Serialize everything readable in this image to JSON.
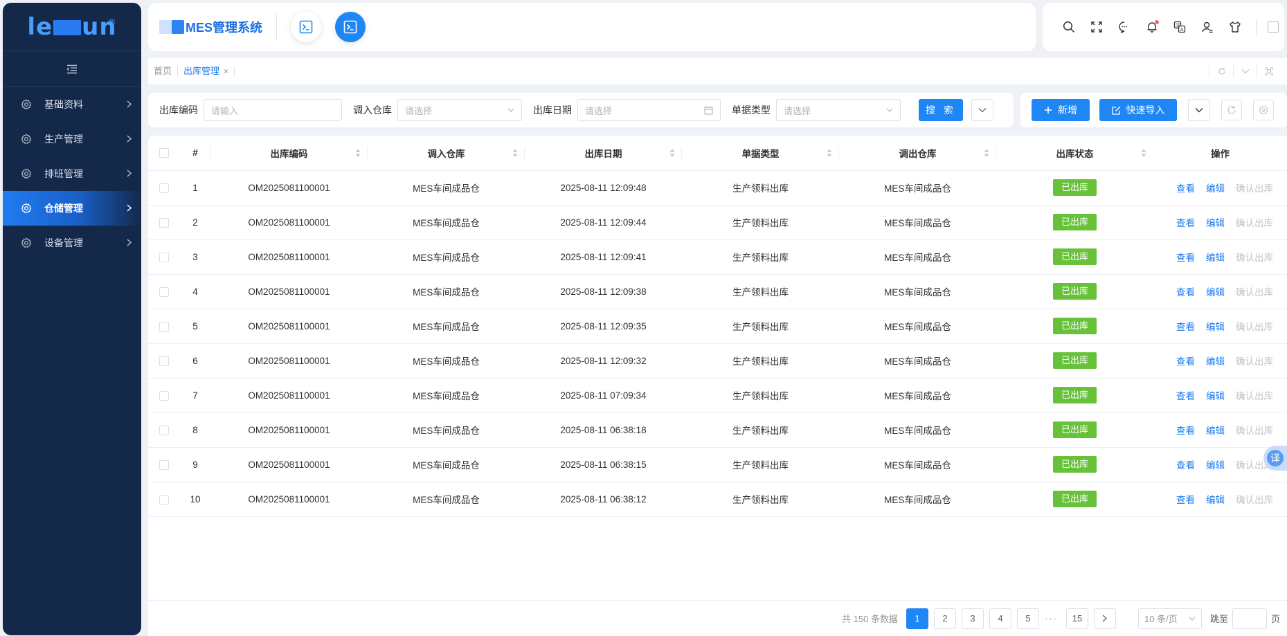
{
  "brand": {
    "logo_text_left": "le",
    "logo_text_right": "un",
    "logo_reg": "®"
  },
  "sidebar": {
    "items": [
      {
        "label": "基础资料",
        "icon": "gear-icon",
        "active": false
      },
      {
        "label": "生产管理",
        "icon": "gear-icon",
        "active": false
      },
      {
        "label": "排班管理",
        "icon": "gear-icon",
        "active": false
      },
      {
        "label": "仓储管理",
        "icon": "gear-icon",
        "active": true
      },
      {
        "label": "设备管理",
        "icon": "gear-icon",
        "active": false
      }
    ]
  },
  "header": {
    "system_title": "MES管理系统"
  },
  "tabs": {
    "home": "首页",
    "current": "出库管理"
  },
  "search": {
    "code_label": "出库编码",
    "code_placeholder": "请输入",
    "in_wh_label": "调入仓库",
    "in_wh_placeholder": "请选择",
    "date_label": "出库日期",
    "date_placeholder": "请选择",
    "type_label": "单据类型",
    "type_placeholder": "请选择",
    "search_btn": "搜 索"
  },
  "actions": {
    "add": "新增",
    "import": "快速导入"
  },
  "table": {
    "columns": [
      "#",
      "出库编码",
      "调入仓库",
      "出库日期",
      "单据类型",
      "调出仓库",
      "出库状态",
      "操作"
    ],
    "rows": [
      {
        "no": "1",
        "code": "OM2025081100001",
        "in_wh": "MES车间成品仓",
        "date": "2025-08-11 12:09:48",
        "type": "生产领料出库",
        "out_wh": "MES车间成品仓",
        "status": "已出库"
      },
      {
        "no": "2",
        "code": "OM2025081100001",
        "in_wh": "MES车间成品仓",
        "date": "2025-08-11 12:09:44",
        "type": "生产领料出库",
        "out_wh": "MES车间成品仓",
        "status": "已出库"
      },
      {
        "no": "3",
        "code": "OM2025081100001",
        "in_wh": "MES车间成品仓",
        "date": "2025-08-11 12:09:41",
        "type": "生产领料出库",
        "out_wh": "MES车间成品仓",
        "status": "已出库"
      },
      {
        "no": "4",
        "code": "OM2025081100001",
        "in_wh": "MES车间成品仓",
        "date": "2025-08-11 12:09:38",
        "type": "生产领料出库",
        "out_wh": "MES车间成品仓",
        "status": "已出库"
      },
      {
        "no": "5",
        "code": "OM2025081100001",
        "in_wh": "MES车间成品仓",
        "date": "2025-08-11 12:09:35",
        "type": "生产领料出库",
        "out_wh": "MES车间成品仓",
        "status": "已出库"
      },
      {
        "no": "6",
        "code": "OM2025081100001",
        "in_wh": "MES车间成品仓",
        "date": "2025-08-11 12:09:32",
        "type": "生产领料出库",
        "out_wh": "MES车间成品仓",
        "status": "已出库"
      },
      {
        "no": "7",
        "code": "OM2025081100001",
        "in_wh": "MES车间成品仓",
        "date": "2025-08-11 07:09:34",
        "type": "生产领料出库",
        "out_wh": "MES车间成品仓",
        "status": "已出库"
      },
      {
        "no": "8",
        "code": "OM2025081100001",
        "in_wh": "MES车间成品仓",
        "date": "2025-08-11 06:38:18",
        "type": "生产领料出库",
        "out_wh": "MES车间成品仓",
        "status": "已出库"
      },
      {
        "no": "9",
        "code": "OM2025081100001",
        "in_wh": "MES车间成品仓",
        "date": "2025-08-11 06:38:15",
        "type": "生产领料出库",
        "out_wh": "MES车间成品仓",
        "status": "已出库"
      },
      {
        "no": "10",
        "code": "OM2025081100001",
        "in_wh": "MES车间成品仓",
        "date": "2025-08-11 06:38:12",
        "type": "生产领料出库",
        "out_wh": "MES车间成品仓",
        "status": "已出库"
      }
    ],
    "ops": {
      "view": "查看",
      "edit": "编辑",
      "confirm": "确认出库"
    }
  },
  "pagination": {
    "total_text": "共 150 条数据",
    "pages": [
      "1",
      "2",
      "3",
      "4",
      "5"
    ],
    "ellipsis": "···",
    "last": "15",
    "page_size": "10 条/页",
    "jump_label": "跳至",
    "page_unit": "页"
  },
  "translate_fab": "译",
  "colors": {
    "primary": "#1f86f5",
    "sidebar": "#14284a",
    "success": "#67c23a"
  }
}
